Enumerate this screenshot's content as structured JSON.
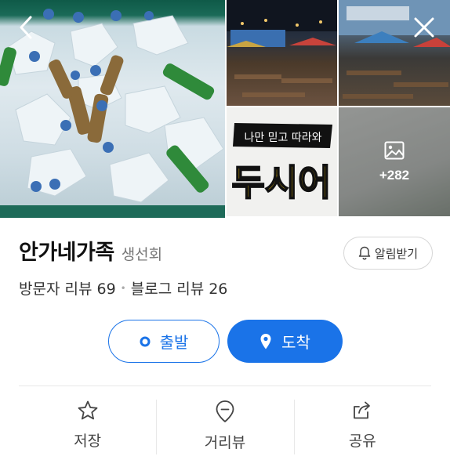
{
  "gallery": {
    "more_count": "+282",
    "sign_text": "나만 믿고 따라와",
    "sign_big": "두시어"
  },
  "place": {
    "name": "안가네가족",
    "category": "생선회",
    "visitor_reviews": "방문자 리뷰 69",
    "blog_reviews": "블로그 리뷰 26"
  },
  "notify": {
    "label": "알림받기"
  },
  "directions": {
    "start_label": "출발",
    "arrive_label": "도착"
  },
  "actions": [
    {
      "label": "저장",
      "icon": "star-icon"
    },
    {
      "label": "거리뷰",
      "icon": "street-view-icon"
    },
    {
      "label": "공유",
      "icon": "share-icon"
    }
  ],
  "colors": {
    "accent": "#1a73e8"
  }
}
